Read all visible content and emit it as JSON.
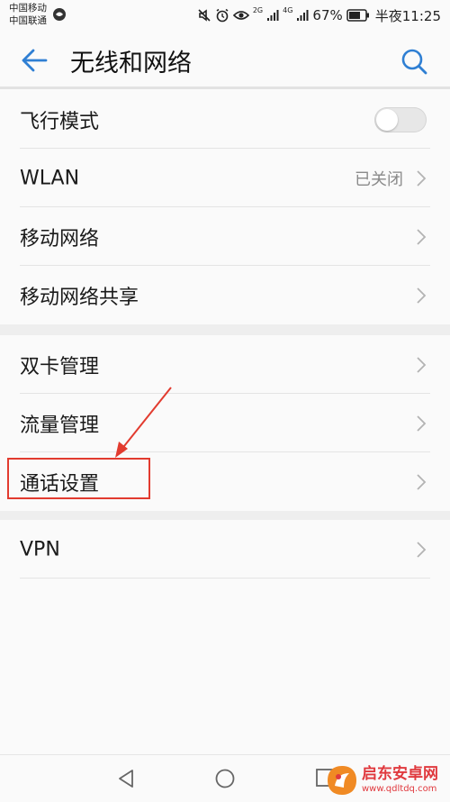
{
  "status_bar": {
    "carrier1": "中国移动",
    "carrier2": "中国联通",
    "network1": "2G",
    "network2": "4G",
    "battery": "67%",
    "time": "半夜11:25"
  },
  "header": {
    "title": "无线和网络",
    "back_icon": "back-arrow-icon",
    "search_icon": "search-icon",
    "accent": "#2f7fd3"
  },
  "sections": [
    {
      "items": [
        {
          "label": "飞行模式",
          "type": "toggle",
          "checked": false
        },
        {
          "label": "WLAN",
          "type": "link",
          "value": "已关闭"
        },
        {
          "label": "移动网络",
          "type": "link"
        },
        {
          "label": "移动网络共享",
          "type": "link"
        }
      ]
    },
    {
      "items": [
        {
          "label": "双卡管理",
          "type": "link"
        },
        {
          "label": "流量管理",
          "type": "link"
        },
        {
          "label": "通话设置",
          "type": "link",
          "highlighted": true
        }
      ]
    },
    {
      "items": [
        {
          "label": "VPN",
          "type": "link"
        }
      ]
    }
  ],
  "annotation": {
    "color": "#e23b2f"
  },
  "nav_bar": {
    "back": "nav-back-icon",
    "home": "nav-home-icon",
    "recent": "nav-recent-icon"
  },
  "watermark": {
    "title": "启东安卓网",
    "url": "www.qdltdq.com"
  }
}
